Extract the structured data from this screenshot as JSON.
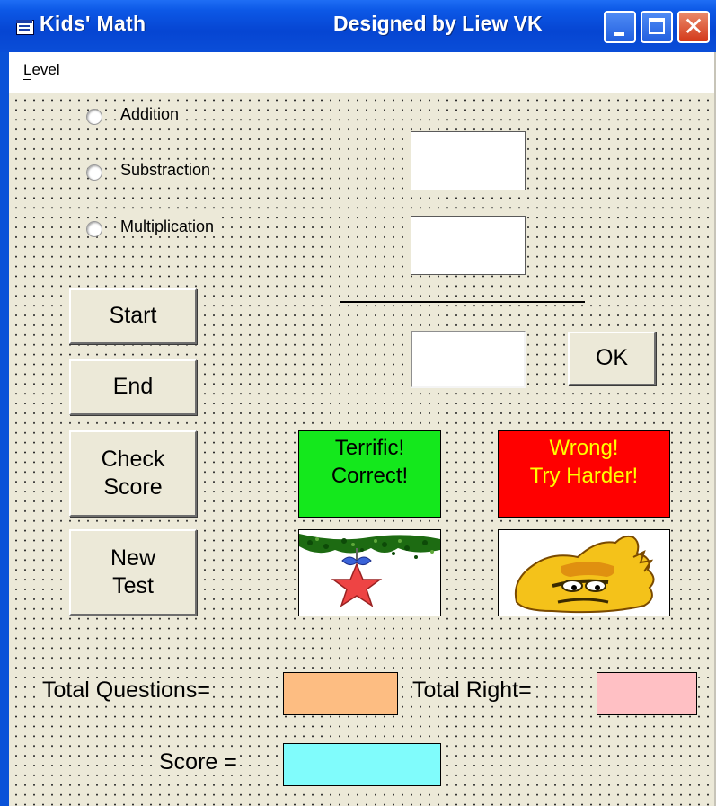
{
  "window": {
    "title": "Kids' Math",
    "title_right": "Designed by Liew VK",
    "icon": "app-window-icon",
    "controls": [
      "minimize",
      "maximize",
      "close"
    ]
  },
  "menu": {
    "items": [
      "Level"
    ]
  },
  "operations": [
    {
      "label": "Addition",
      "selected": false
    },
    {
      "label": "Substraction",
      "selected": false
    },
    {
      "label": "Multiplication",
      "selected": false
    }
  ],
  "problem": {
    "first_number": "",
    "second_number": "",
    "answer": ""
  },
  "buttons": {
    "ok": "OK",
    "start": "Start",
    "end": "End",
    "check_score": "Check\nScore",
    "new_test": "New\nTest"
  },
  "feedback": {
    "correct": "Terrific!\nCorrect!",
    "wrong": "Wrong!\nTry Harder!",
    "correct_color": "#14e81c",
    "wrong_color": "#ff0000",
    "wrong_text_color": "#ffff00",
    "correct_image": "star-ornament-icon",
    "wrong_image": "grumpy-face-icon"
  },
  "stats": {
    "total_questions_label": "Total Questions=",
    "total_questions_value": "",
    "total_right_label": "Total Right=",
    "total_right_value": "",
    "score_label": "Score =",
    "score_value": "",
    "total_questions_color": "#fdbd82",
    "total_right_color": "#ffc0c4",
    "score_color": "#80fcfc"
  }
}
